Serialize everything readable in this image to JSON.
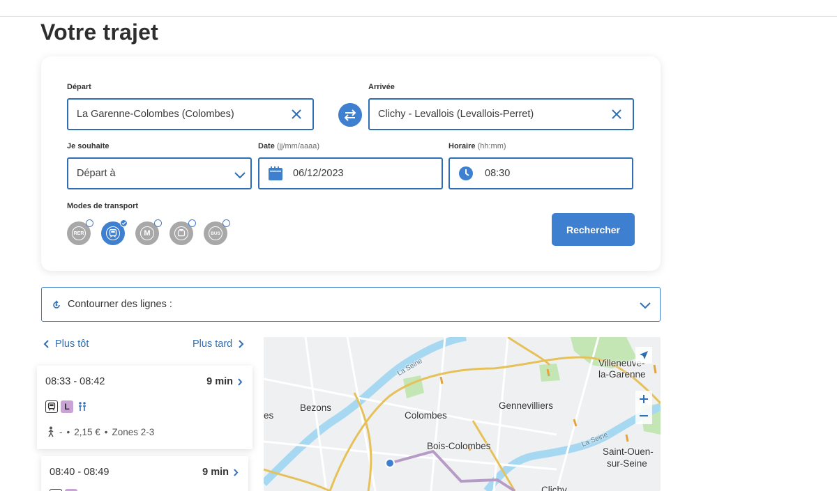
{
  "page": {
    "title": "Votre trajet"
  },
  "form": {
    "depart_label": "Départ",
    "depart_value": "La Garenne-Colombes (Colombes)",
    "arrivee_label": "Arrivée",
    "arrivee_value": "Clichy - Levallois (Levallois-Perret)",
    "souhaite_label": "Je souhaite",
    "souhaite_value": "Départ à",
    "date_label": "Date",
    "date_hint": "(jj/mm/aaaa)",
    "date_value": "06/12/2023",
    "horaire_label": "Horaire",
    "horaire_hint": "(hh:mm)",
    "horaire_value": "08:30",
    "modes_label": "Modes de transport",
    "modes": [
      {
        "name": "RER",
        "short": "RER",
        "selected": false
      },
      {
        "name": "Train",
        "short": "",
        "selected": true
      },
      {
        "name": "Metro",
        "short": "M",
        "selected": false
      },
      {
        "name": "Tram",
        "short": "",
        "selected": false
      },
      {
        "name": "Bus",
        "short": "BUS",
        "selected": false
      }
    ],
    "search_label": "Rechercher"
  },
  "avoid": {
    "label": "Contourner des lignes :"
  },
  "results": {
    "earlier_label": "Plus tôt",
    "later_label": "Plus tard",
    "trips": [
      {
        "time": "08:33 - 08:42",
        "duration": "9 min",
        "line": "L",
        "walk": "-",
        "price": "2,15 €",
        "zones": "Zones 2-3"
      },
      {
        "time": "08:40 - 08:49",
        "duration": "9 min",
        "line": "L"
      }
    ]
  },
  "map": {
    "labels": {
      "villeneuve": "Villeneuve-",
      "garenne": "la-Garenne",
      "bezons": "Bezons",
      "gennevilliers": "Gennevilliers",
      "colombes": "Colombes",
      "bois_colombes": "Bois-Colombes",
      "saint_ouen": "Saint-Ouen-",
      "sur_seine": "sur-Seine",
      "seine_1": "La Seine",
      "seine_2": "La Seine",
      "es": "es",
      "clichy": "Clichy"
    }
  },
  "colors": {
    "accent": "#3f7fcf",
    "line_l": "#c9a3d6",
    "road": "#e6c15a",
    "water": "#a6d8f2",
    "park": "#c4e6b4"
  }
}
